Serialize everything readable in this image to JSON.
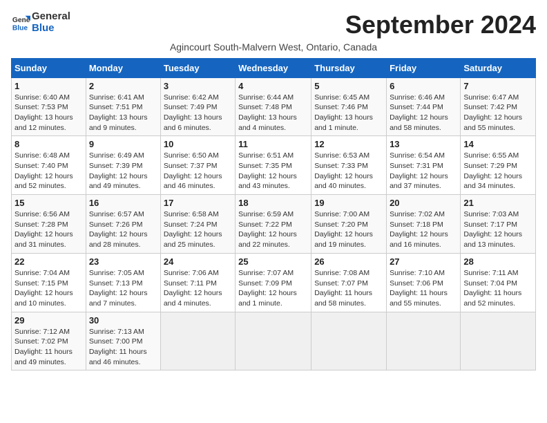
{
  "header": {
    "logo_line1": "General",
    "logo_line2": "Blue",
    "month_title": "September 2024",
    "location": "Agincourt South-Malvern West, Ontario, Canada"
  },
  "days_of_week": [
    "Sunday",
    "Monday",
    "Tuesday",
    "Wednesday",
    "Thursday",
    "Friday",
    "Saturday"
  ],
  "weeks": [
    [
      {
        "day": "1",
        "sunrise": "6:40 AM",
        "sunset": "7:53 PM",
        "daylight": "13 hours and 12 minutes"
      },
      {
        "day": "2",
        "sunrise": "6:41 AM",
        "sunset": "7:51 PM",
        "daylight": "13 hours and 9 minutes"
      },
      {
        "day": "3",
        "sunrise": "6:42 AM",
        "sunset": "7:49 PM",
        "daylight": "13 hours and 6 minutes"
      },
      {
        "day": "4",
        "sunrise": "6:44 AM",
        "sunset": "7:48 PM",
        "daylight": "13 hours and 4 minutes"
      },
      {
        "day": "5",
        "sunrise": "6:45 AM",
        "sunset": "7:46 PM",
        "daylight": "13 hours and 1 minute"
      },
      {
        "day": "6",
        "sunrise": "6:46 AM",
        "sunset": "7:44 PM",
        "daylight": "12 hours and 58 minutes"
      },
      {
        "day": "7",
        "sunrise": "6:47 AM",
        "sunset": "7:42 PM",
        "daylight": "12 hours and 55 minutes"
      }
    ],
    [
      {
        "day": "8",
        "sunrise": "6:48 AM",
        "sunset": "7:40 PM",
        "daylight": "12 hours and 52 minutes"
      },
      {
        "day": "9",
        "sunrise": "6:49 AM",
        "sunset": "7:39 PM",
        "daylight": "12 hours and 49 minutes"
      },
      {
        "day": "10",
        "sunrise": "6:50 AM",
        "sunset": "7:37 PM",
        "daylight": "12 hours and 46 minutes"
      },
      {
        "day": "11",
        "sunrise": "6:51 AM",
        "sunset": "7:35 PM",
        "daylight": "12 hours and 43 minutes"
      },
      {
        "day": "12",
        "sunrise": "6:53 AM",
        "sunset": "7:33 PM",
        "daylight": "12 hours and 40 minutes"
      },
      {
        "day": "13",
        "sunrise": "6:54 AM",
        "sunset": "7:31 PM",
        "daylight": "12 hours and 37 minutes"
      },
      {
        "day": "14",
        "sunrise": "6:55 AM",
        "sunset": "7:29 PM",
        "daylight": "12 hours and 34 minutes"
      }
    ],
    [
      {
        "day": "15",
        "sunrise": "6:56 AM",
        "sunset": "7:28 PM",
        "daylight": "12 hours and 31 minutes"
      },
      {
        "day": "16",
        "sunrise": "6:57 AM",
        "sunset": "7:26 PM",
        "daylight": "12 hours and 28 minutes"
      },
      {
        "day": "17",
        "sunrise": "6:58 AM",
        "sunset": "7:24 PM",
        "daylight": "12 hours and 25 minutes"
      },
      {
        "day": "18",
        "sunrise": "6:59 AM",
        "sunset": "7:22 PM",
        "daylight": "12 hours and 22 minutes"
      },
      {
        "day": "19",
        "sunrise": "7:00 AM",
        "sunset": "7:20 PM",
        "daylight": "12 hours and 19 minutes"
      },
      {
        "day": "20",
        "sunrise": "7:02 AM",
        "sunset": "7:18 PM",
        "daylight": "12 hours and 16 minutes"
      },
      {
        "day": "21",
        "sunrise": "7:03 AM",
        "sunset": "7:17 PM",
        "daylight": "12 hours and 13 minutes"
      }
    ],
    [
      {
        "day": "22",
        "sunrise": "7:04 AM",
        "sunset": "7:15 PM",
        "daylight": "12 hours and 10 minutes"
      },
      {
        "day": "23",
        "sunrise": "7:05 AM",
        "sunset": "7:13 PM",
        "daylight": "12 hours and 7 minutes"
      },
      {
        "day": "24",
        "sunrise": "7:06 AM",
        "sunset": "7:11 PM",
        "daylight": "12 hours and 4 minutes"
      },
      {
        "day": "25",
        "sunrise": "7:07 AM",
        "sunset": "7:09 PM",
        "daylight": "12 hours and 1 minute"
      },
      {
        "day": "26",
        "sunrise": "7:08 AM",
        "sunset": "7:07 PM",
        "daylight": "11 hours and 58 minutes"
      },
      {
        "day": "27",
        "sunrise": "7:10 AM",
        "sunset": "7:06 PM",
        "daylight": "11 hours and 55 minutes"
      },
      {
        "day": "28",
        "sunrise": "7:11 AM",
        "sunset": "7:04 PM",
        "daylight": "11 hours and 52 minutes"
      }
    ],
    [
      {
        "day": "29",
        "sunrise": "7:12 AM",
        "sunset": "7:02 PM",
        "daylight": "11 hours and 49 minutes"
      },
      {
        "day": "30",
        "sunrise": "7:13 AM",
        "sunset": "7:00 PM",
        "daylight": "11 hours and 46 minutes"
      },
      null,
      null,
      null,
      null,
      null
    ]
  ]
}
